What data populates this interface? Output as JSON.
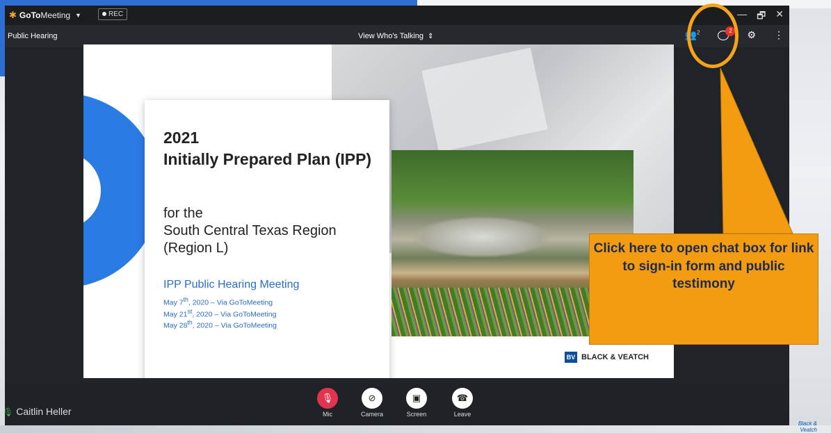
{
  "app": {
    "brand_bold": "GoTo",
    "brand_rest": "Meeting",
    "rec_label": "REC"
  },
  "window": {
    "minimize": "—",
    "restore": "🗗",
    "close": "✕"
  },
  "subbar": {
    "meeting_name": "Public Hearing",
    "view_label": "View Who's Talking",
    "participants_count": "2",
    "chat_badge": "2"
  },
  "slide": {
    "year": "2021",
    "title": "Initially Prepared Plan (IPP)",
    "for_line1": "for the",
    "for_line2": "South Central Texas Region",
    "for_line3": "(Region L)",
    "meeting_title": "IPP Public Hearing Meeting",
    "dates": [
      {
        "month_day": "May 7",
        "suffix": "th",
        "rest": ", 2020 – Via GoToMeeting"
      },
      {
        "month_day": "May 21",
        "suffix": "st",
        "rest": ", 2020 – Via GoToMeeting"
      },
      {
        "month_day": "May 28",
        "suffix": "th",
        "rest": ", 2020 – Via GoToMeeting"
      }
    ],
    "logo_text": "BLACK & VEATCH"
  },
  "controls": {
    "mic": "Mic",
    "camera": "Camera",
    "screen": "Screen",
    "leave": "Leave"
  },
  "presenter": "Caitlin Heller",
  "callout": {
    "text": "Click here to open chat box for link to sign-in form and public testimony",
    "color": "#f39c12"
  },
  "footer": {
    "line1": "Black &",
    "line2": "Veatch"
  }
}
